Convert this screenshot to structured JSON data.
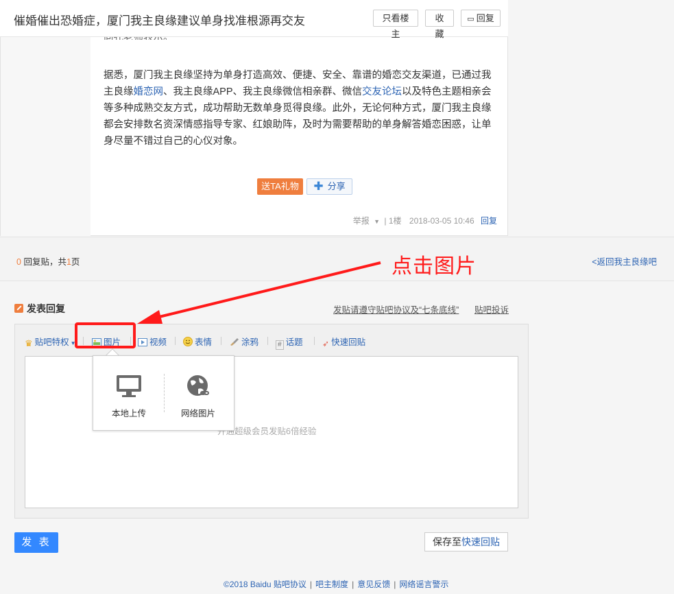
{
  "thread": {
    "title": "催婚催出恐婚症，厦门我主良缘建议单身找准根源再交友",
    "buttons": {
      "only_op": "只看楼主",
      "favorite": "收藏",
      "reply": "回复"
    }
  },
  "post": {
    "faded_line": "向孔老师表示。",
    "paragraph": {
      "part1": "据悉，厦门我主良缘坚持为单身打造高效、便捷、安全、靠谱的婚恋交友渠道，已通过我主良缘",
      "link1": "婚恋网",
      "part2": "、我主良缘APP、我主良缘微信相亲群、微信",
      "link2": "交友论坛",
      "part3": "以及特色主题相亲会等多种成熟交友方式，成功帮助无数单身觅得良缘。此外，无论何种方式，厦门我主良缘都会安排数名资深情感指导专家、红娘助阵，及时为需要帮助的单身解答婚恋困惑，让单身尽量不错过自己的心仪对象。"
    },
    "gift_label": "送TA礼物",
    "share_label": "分享",
    "report_label": "举报",
    "floor": "| 1楼",
    "timestamp": "2018-03-05 10:46",
    "reply_label": "回复"
  },
  "pager": {
    "count": "0",
    "text1": "回复贴，共",
    "pages": "1",
    "text2": "页",
    "back_link": "<返回我主良缘吧"
  },
  "annotation": {
    "text": "点击图片",
    "color": "#ff1a1a"
  },
  "reply_form": {
    "title": "发表回复",
    "rules_link": "发贴请遵守贴吧协议及“七条底线”",
    "report_link": "贴吧投诉",
    "toolbar": {
      "privilege": "贴吧特权",
      "image": "图片",
      "video": "视频",
      "emoji": "表情",
      "doodle": "涂鸦",
      "topic": "话题",
      "quick_reply": "快速回贴"
    },
    "placeholder": "开通超级会员发贴6倍经验",
    "image_popup": {
      "local": "本地上传",
      "web": "网络图片"
    },
    "submit_label": "发 表",
    "save_prefix": "保存至",
    "save_highlight": "快速回贴"
  },
  "footer": {
    "copyright": "©2018 Baidu",
    "links": [
      "贴吧协议",
      "吧主制度",
      "意见反馈",
      "网络谣言警示"
    ]
  },
  "colors": {
    "accent_blue": "#3388ff",
    "link_blue": "#2d64b3",
    "orange": "#ef7e3e"
  }
}
